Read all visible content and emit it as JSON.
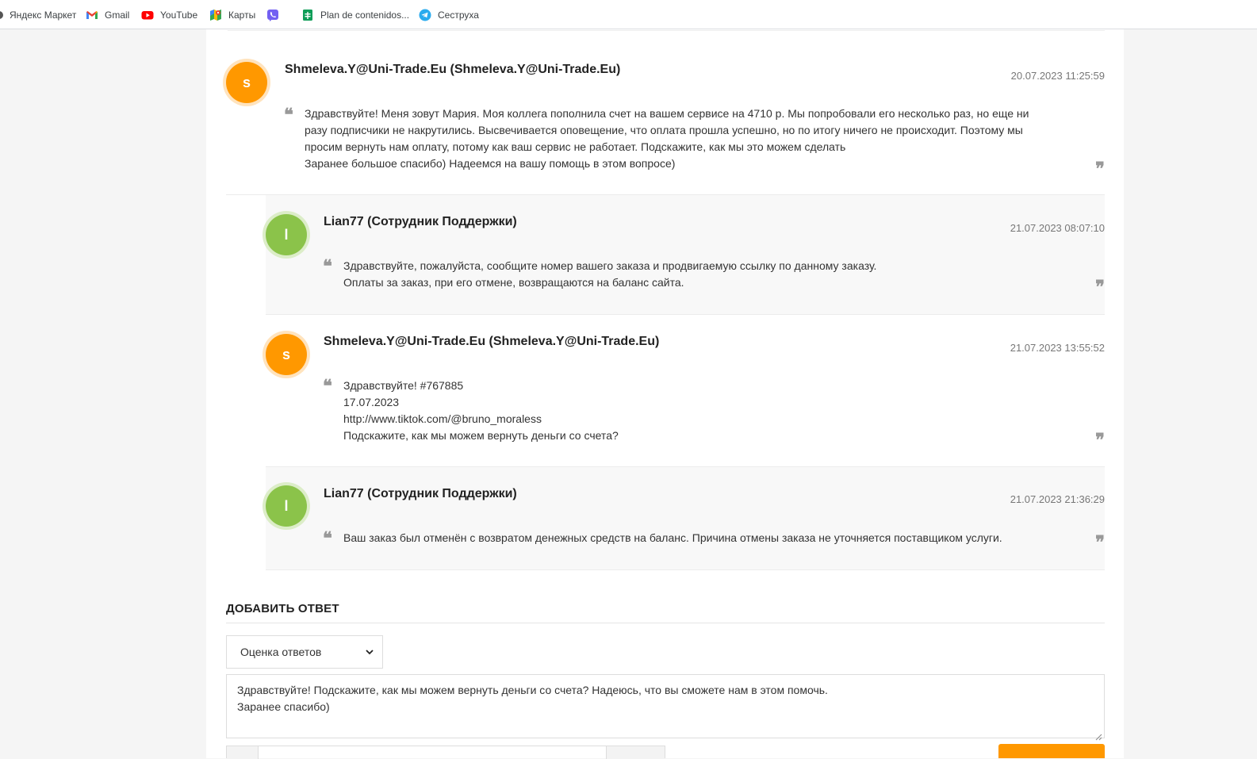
{
  "bookmarks": [
    {
      "label": "Яндекс Маркет",
      "icon": "yandex-icon"
    },
    {
      "label": "Gmail",
      "icon": "gmail-icon"
    },
    {
      "label": "YouTube",
      "icon": "youtube-icon"
    },
    {
      "label": "Карты",
      "icon": "maps-icon"
    },
    {
      "label": "",
      "icon": "viber-icon"
    },
    {
      "label": "Plan de contenidos...",
      "icon": "sheets-icon"
    },
    {
      "label": "Сеструха",
      "icon": "telegram-icon"
    }
  ],
  "messages": [
    {
      "avatar_letter": "s",
      "author": "Shmeleva.Y@Uni-Trade.Eu (Shmeleva.Y@Uni-Trade.Eu)",
      "date": "20.07.2023 11:25:59",
      "lines": [
        "Здравствуйте! Меня зовут Мария. Моя коллега пополнила счет на вашем сервисе на 4710 р. Мы попробовали его несколько раз, но еще ни",
        "разу подписчики не накрутились. Высвечивается оповещение, что оплата прошла успешно, но по итогу ничего не происходит. Поэтому мы",
        "просим вернуть нам оплату, потому как ваш сервис не работает. Подскажите, как мы это можем сделать",
        "Заранее большое спасибо) Надеемся на вашу помощь в этом вопросе)"
      ]
    },
    {
      "avatar_letter": "l",
      "author": "Lian77 (Сотрудник Поддержки)",
      "date": "21.07.2023 08:07:10",
      "lines": [
        "Здравствуйте, пожалуйста, сообщите номер вашего заказа и продвигаемую ссылку по данному заказу.",
        "Оплаты за заказ, при его отмене, возвращаются на баланс сайта."
      ]
    },
    {
      "avatar_letter": "s",
      "author": "Shmeleva.Y@Uni-Trade.Eu (Shmeleva.Y@Uni-Trade.Eu)",
      "date": "21.07.2023 13:55:52",
      "lines": [
        "Здравствуйте! #767885",
        "17.07.2023",
        "http://www.tiktok.com/@bruno_moraless",
        "Подскажите, как мы можем вернуть деньги со счета?"
      ]
    },
    {
      "avatar_letter": "l",
      "author": "Lian77 (Сотрудник Поддержки)",
      "date": "21.07.2023 21:36:29",
      "lines": [
        "Ваш заказ был отменён с возвратом денежных средств на баланс. Причина отмены заказа не уточняется поставщиком услуги."
      ]
    }
  ],
  "reply": {
    "title": "ДОБАВИТЬ ОТВЕТ",
    "rating_select": "Оценка ответов",
    "textarea_lines": [
      "Здравствуйте! Подскажите, как мы можем вернуть деньги со счета? Надеюсь, что вы сможете нам в этом помочь.",
      "Заранее спасибо)"
    ]
  },
  "colors": {
    "user_avatar": "#ff9800",
    "support_avatar": "#8bc34a",
    "submit_button": "#ff9800"
  }
}
